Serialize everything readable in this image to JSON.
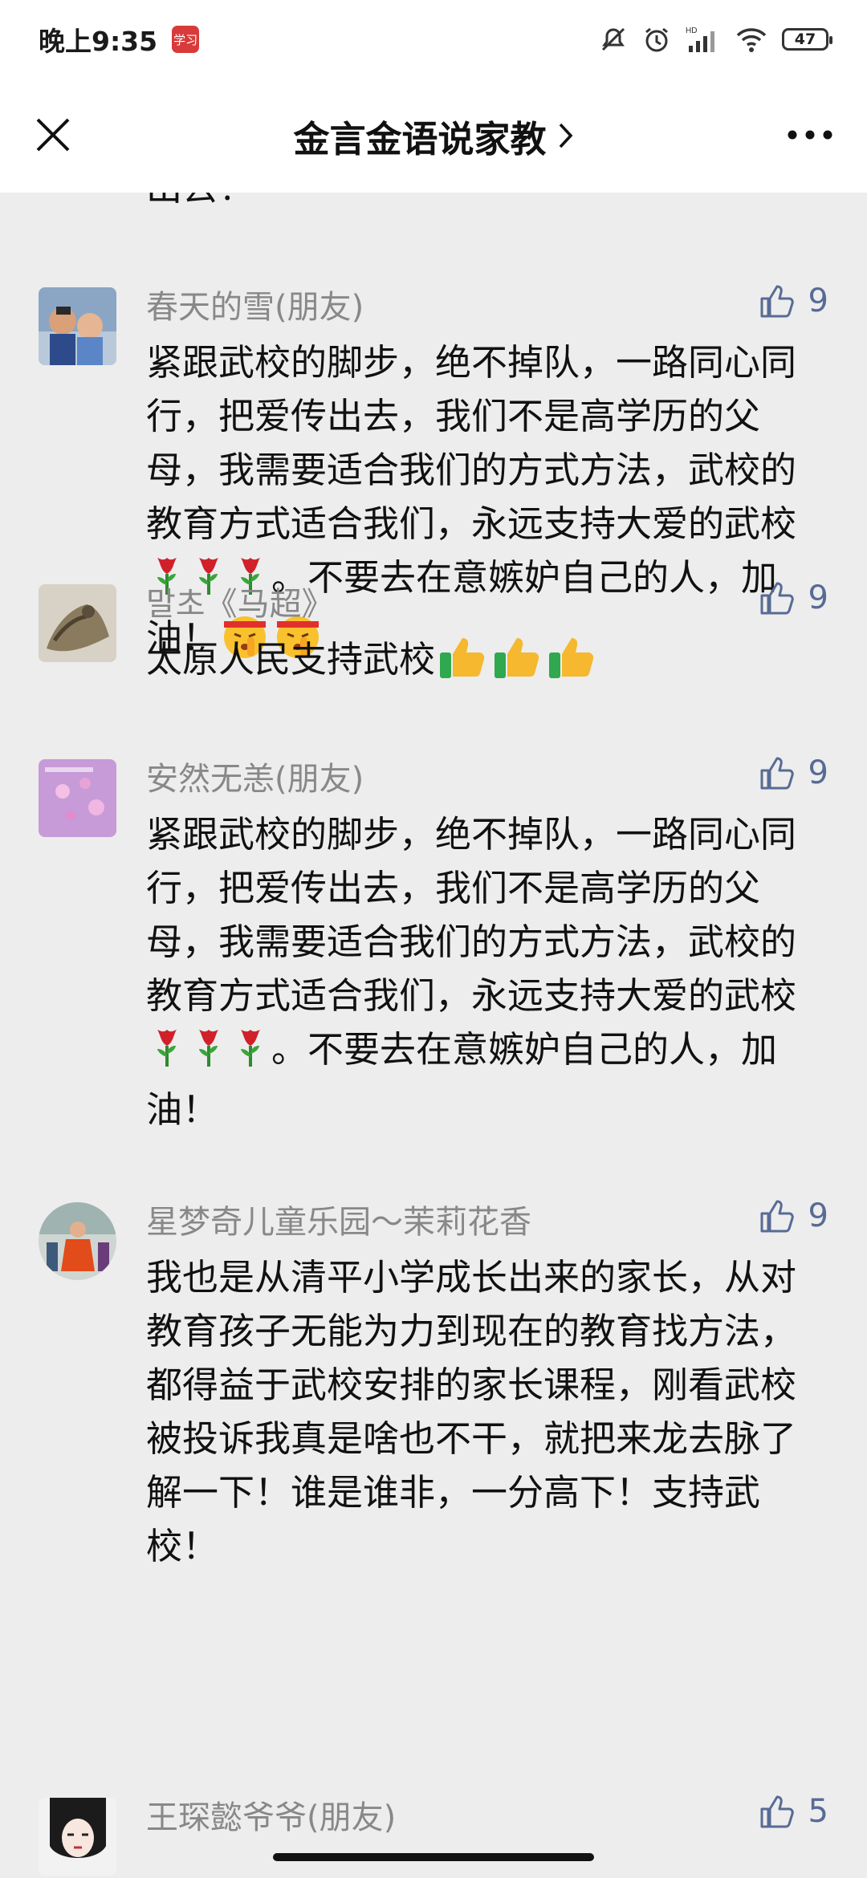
{
  "status": {
    "time": "晚上9:35",
    "badge": "学习",
    "battery": "47",
    "icons": [
      "mute-icon",
      "alarm-icon",
      "hd-signal-icon",
      "wifi-icon",
      "battery-icon"
    ]
  },
  "nav": {
    "title": "金言金语说家教",
    "close_icon": "close-icon",
    "more_icon": "more-icon",
    "accent": "#576b95"
  },
  "cut_text": "出去！",
  "comments": [
    {
      "name": "春天的雪(朋友)",
      "likes": "9",
      "text_a": "紧跟武校的脚步，绝不掉队，一路同心同行，把爱传出去，我们不是高学历的父母，我需要适合我们的方式方法，武校的教育方式适合我们，永远支持大爱的武校",
      "text_b": "。不要去在意嫉妒自己的人，加油！"
    },
    {
      "name": "말초《马超》",
      "likes": "9",
      "text_a": "太原人民支持武校"
    },
    {
      "name": "安然无恙(朋友)",
      "likes": "9",
      "text_a": "紧跟武校的脚步，绝不掉队，一路同心同行，把爱传出去，我们不是高学历的父母，我需要适合我们的方式方法，武校的教育方式适合我们，永远支持大爱的武校",
      "text_b": "。不要去在意嫉妒自己的人，加油！"
    },
    {
      "name": "星梦奇儿童乐园～茉莉花香",
      "likes": "9",
      "text_a": "我也是从清平小学成长出来的家长，从对教育孩子无能为力到现在的教育找方法，都得益于武校安排的家长课程，刚看武校被投诉我真是啥也不干，就把来龙去脉了解一下！谁是谁非，一分高下！支持武校！"
    },
    {
      "name": "王琛懿爷爷(朋友)",
      "likes": "5"
    }
  ]
}
